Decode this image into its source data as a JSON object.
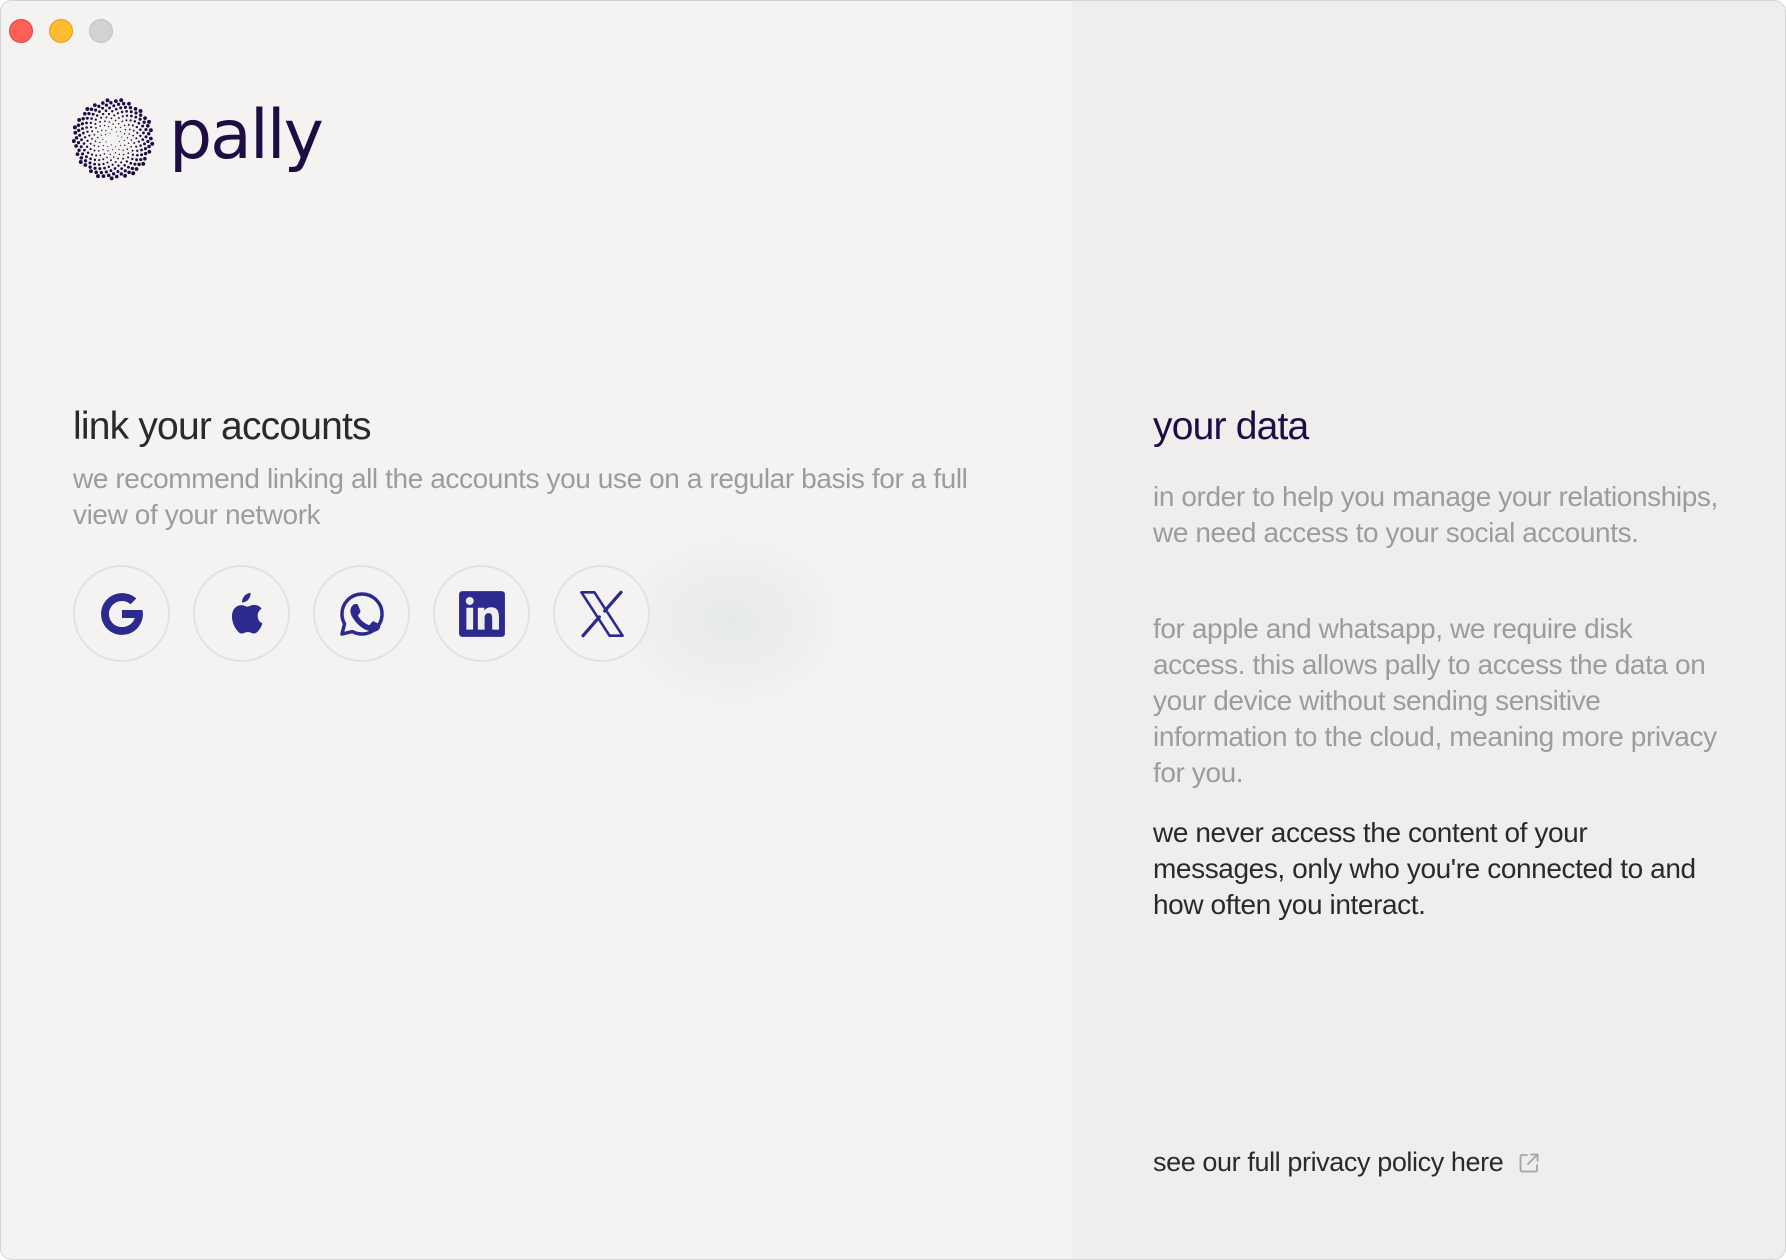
{
  "app": {
    "name": "pally"
  },
  "window": {
    "controls": [
      "close",
      "minimize",
      "zoom"
    ]
  },
  "link_accounts": {
    "title": "link your accounts",
    "description": "we recommend linking all the accounts you use on a regular basis for a full view of your network",
    "accounts": [
      {
        "name": "google",
        "icon": "google-icon"
      },
      {
        "name": "apple",
        "icon": "apple-icon"
      },
      {
        "name": "whatsapp",
        "icon": "whatsapp-icon"
      },
      {
        "name": "linkedin",
        "icon": "linkedin-icon"
      },
      {
        "name": "x",
        "icon": "x-icon"
      }
    ]
  },
  "your_data": {
    "title": "your data",
    "paragraph1": "in order to help you manage your relationships, we need access to your social accounts.",
    "paragraph2": "for apple and whatsapp, we require disk access. this allows pally to access the data on your device without sending sensitive information to the cloud, meaning more privacy for you.",
    "paragraph3": "we never access the content of your messages, only who you're connected to and how often you interact.",
    "privacy_link": "see our full privacy policy here"
  },
  "colors": {
    "brand": "#1e0c45",
    "icon_accent": "#2d2a8f",
    "muted_text": "#9c9c9f",
    "body_text": "#2a2a2e"
  }
}
